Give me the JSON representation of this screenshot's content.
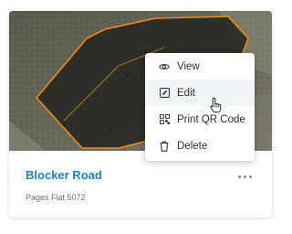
{
  "card": {
    "title": "Blocker Road",
    "subtitle": "Pages Flat 5072",
    "more_icon": "more-horizontal-icon"
  },
  "menu": {
    "items": [
      {
        "label": "View",
        "icon": "eye-icon"
      },
      {
        "label": "Edit",
        "icon": "edit-icon"
      },
      {
        "label": "Print QR Code",
        "icon": "qr-code-icon"
      },
      {
        "label": "Delete",
        "icon": "trash-icon"
      }
    ],
    "hovered_item": "Edit"
  },
  "colors": {
    "title_link": "#1f7fc4",
    "boundary": "#f08a1c",
    "menu_hover": "#f1f5f8"
  }
}
